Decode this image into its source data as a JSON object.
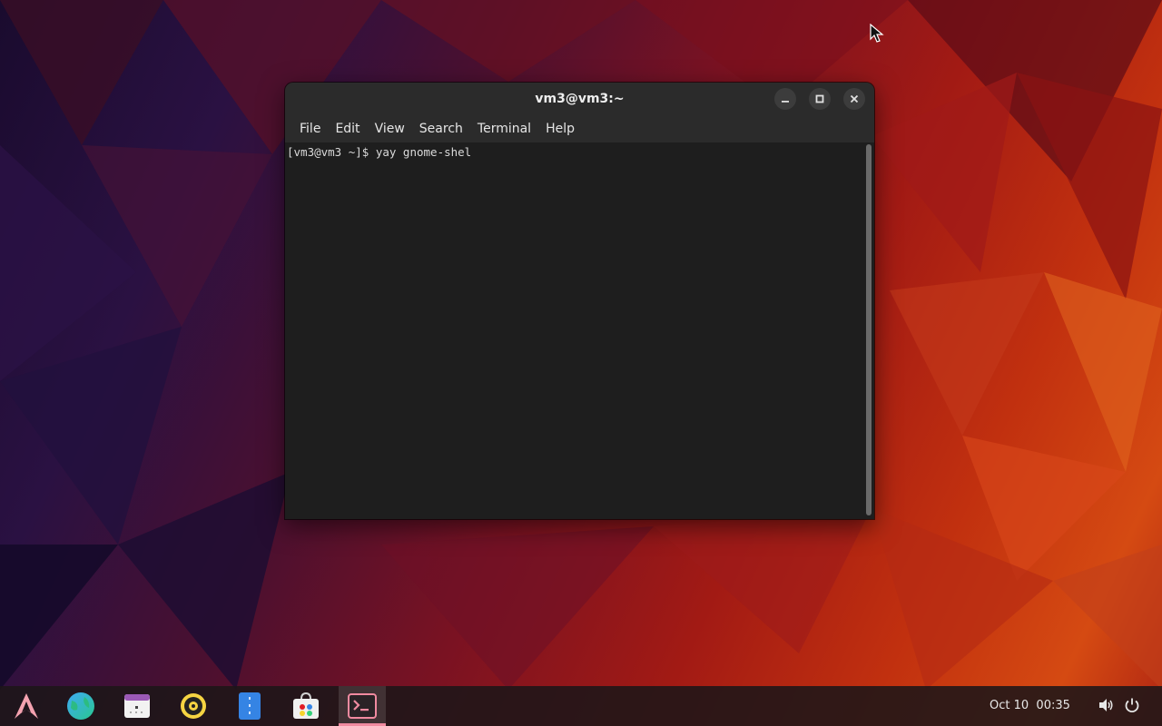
{
  "window": {
    "title": "vm3@vm3:~",
    "menu": [
      "File",
      "Edit",
      "View",
      "Search",
      "Terminal",
      "Help"
    ],
    "terminal_line": "[vm3@vm3 ~]$ yay gnome-shel"
  },
  "taskbar": {
    "apps": [
      {
        "icon": "arch-logo-icon"
      },
      {
        "icon": "web-browser-icon"
      },
      {
        "icon": "calendar-icon"
      },
      {
        "icon": "music-player-icon"
      },
      {
        "icon": "file-manager-icon"
      },
      {
        "icon": "software-store-icon"
      },
      {
        "icon": "terminal-icon",
        "active": true
      }
    ],
    "date": "Oct 10",
    "time": "00:35",
    "tray": [
      "volume-icon",
      "power-icon"
    ],
    "accent": "#f08aa0"
  }
}
